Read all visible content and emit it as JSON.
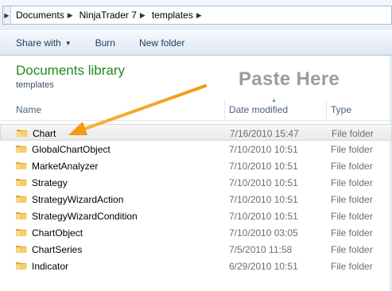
{
  "address": {
    "crumbs": [
      "Documents",
      "NinjaTrader 7",
      "templates"
    ]
  },
  "toolbar": {
    "share_label": "Share with",
    "burn_label": "Burn",
    "new_folder_label": "New folder"
  },
  "library": {
    "title": "Documents library",
    "subtitle": "templates"
  },
  "annotation": {
    "text": "Paste Here",
    "arrow_color": "#f5a11b"
  },
  "columns": {
    "name": "Name",
    "date": "Date modified",
    "type": "Type"
  },
  "files": [
    {
      "name": "Chart",
      "date": "7/16/2010 15:47",
      "type": "File folder",
      "selected": true
    },
    {
      "name": "GlobalChartObject",
      "date": "7/10/2010 10:51",
      "type": "File folder"
    },
    {
      "name": "MarketAnalyzer",
      "date": "7/10/2010 10:51",
      "type": "File folder"
    },
    {
      "name": "Strategy",
      "date": "7/10/2010 10:51",
      "type": "File folder"
    },
    {
      "name": "StrategyWizardAction",
      "date": "7/10/2010 10:51",
      "type": "File folder"
    },
    {
      "name": "StrategyWizardCondition",
      "date": "7/10/2010 10:51",
      "type": "File folder"
    },
    {
      "name": "ChartObject",
      "date": "7/10/2010 03:05",
      "type": "File folder"
    },
    {
      "name": "ChartSeries",
      "date": "7/5/2010 11:58",
      "type": "File folder"
    },
    {
      "name": "Indicator",
      "date": "6/29/2010 10:51",
      "type": "File folder"
    }
  ],
  "colors": {
    "library_title": "#1e8a1e",
    "folder": "#e8c15a"
  }
}
